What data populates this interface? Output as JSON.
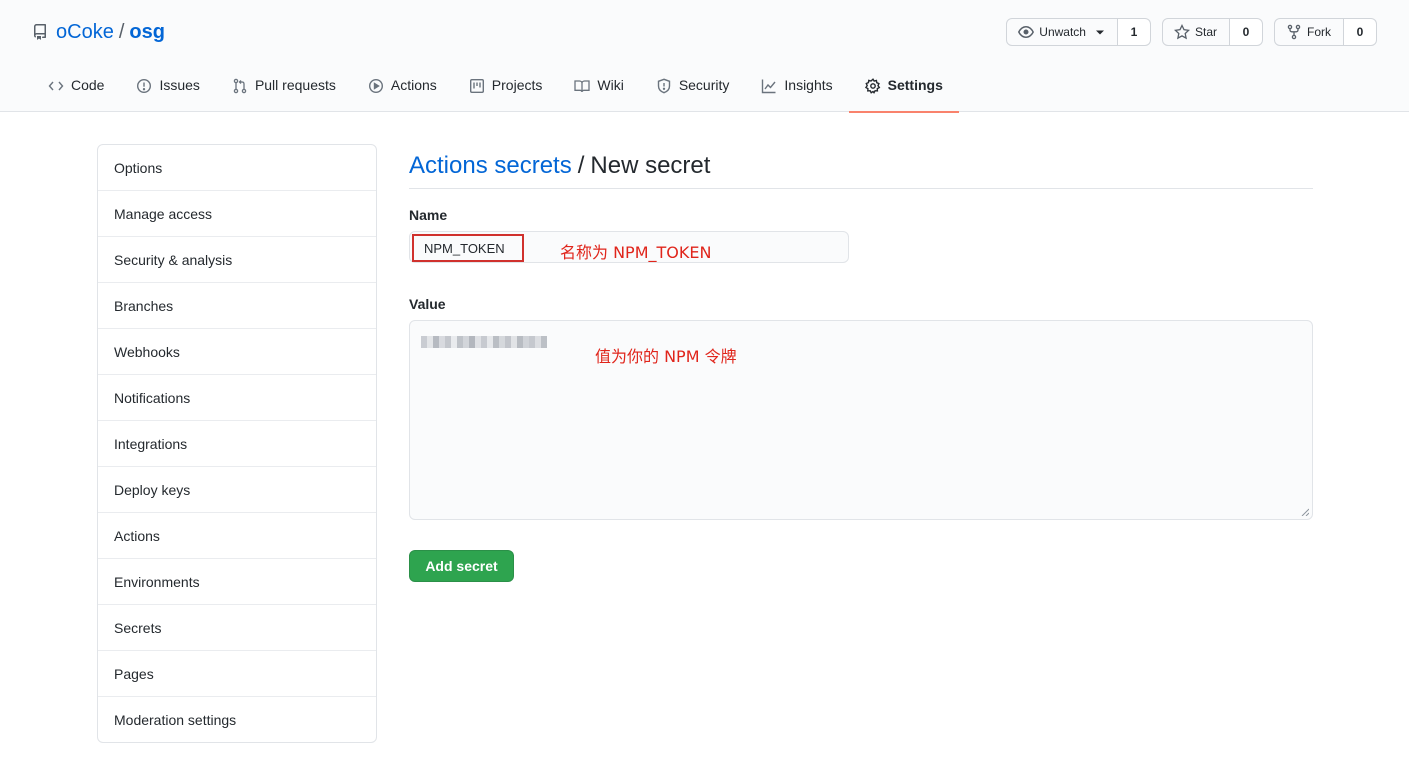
{
  "repo": {
    "owner": "oCoke",
    "separator": "/",
    "name": "osg",
    "icon": "repo-icon"
  },
  "actions": {
    "watch": {
      "label": "Unwatch",
      "count": "1",
      "icon": "eye-icon"
    },
    "star": {
      "label": "Star",
      "count": "0",
      "icon": "star-icon"
    },
    "fork": {
      "label": "Fork",
      "count": "0",
      "icon": "fork-icon"
    }
  },
  "tabs": [
    {
      "label": "Code",
      "icon": "code-icon"
    },
    {
      "label": "Issues",
      "icon": "issue-icon"
    },
    {
      "label": "Pull requests",
      "icon": "pull-request-icon"
    },
    {
      "label": "Actions",
      "icon": "play-icon"
    },
    {
      "label": "Projects",
      "icon": "project-icon"
    },
    {
      "label": "Wiki",
      "icon": "book-icon"
    },
    {
      "label": "Security",
      "icon": "shield-icon"
    },
    {
      "label": "Insights",
      "icon": "graph-icon"
    },
    {
      "label": "Settings",
      "icon": "gear-icon",
      "selected": true
    }
  ],
  "sidebar": {
    "items": [
      {
        "label": "Options"
      },
      {
        "label": "Manage access"
      },
      {
        "label": "Security & analysis"
      },
      {
        "label": "Branches"
      },
      {
        "label": "Webhooks"
      },
      {
        "label": "Notifications"
      },
      {
        "label": "Integrations"
      },
      {
        "label": "Deploy keys"
      },
      {
        "label": "Actions"
      },
      {
        "label": "Environments"
      },
      {
        "label": "Secrets"
      },
      {
        "label": "Pages"
      },
      {
        "label": "Moderation settings"
      }
    ]
  },
  "form": {
    "breadcrumb_link": "Actions secrets",
    "breadcrumb_sep": "/",
    "breadcrumb_current": "New secret",
    "name_label": "Name",
    "name_value": "NPM_TOKEN",
    "name_annotation": "名称为 NPM_TOKEN",
    "value_label": "Value",
    "value_annotation": "值为你的 NPM 令牌",
    "submit_label": "Add secret"
  },
  "colors": {
    "link": "#0366d6",
    "primary_button": "#2ea44f",
    "selected_tab_underline": "#f9826c",
    "annotation": "#e0251b"
  }
}
